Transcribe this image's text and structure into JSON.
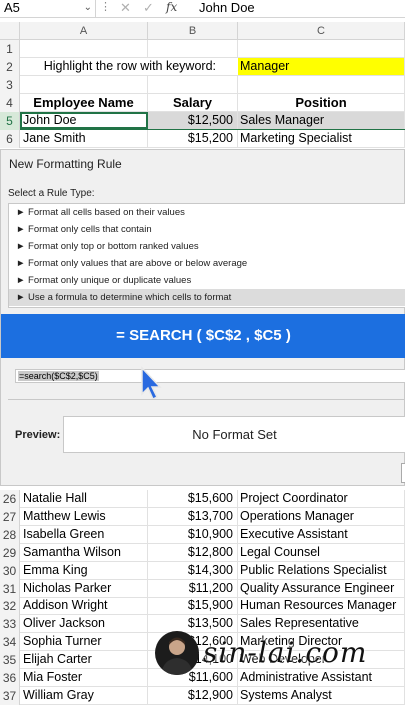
{
  "formula_bar": {
    "name_box": "A5",
    "cancel_icon": "✕",
    "enter_icon": "✓",
    "fx": "fx",
    "value": "John Doe"
  },
  "columns": [
    "A",
    "B",
    "C"
  ],
  "top_rows": [
    {
      "num": "1",
      "a": "",
      "b": "",
      "c": ""
    },
    {
      "num": "2",
      "label": "Highlight the row with keyword:",
      "keyword": "Manager"
    },
    {
      "num": "3",
      "a": "",
      "b": "",
      "c": ""
    },
    {
      "num": "4",
      "a": "Employee Name",
      "b": "Salary",
      "c": "Position"
    },
    {
      "num": "5",
      "a": "John Doe",
      "b": "$12,500",
      "c": "Sales Manager"
    },
    {
      "num": "6",
      "a": "Jane Smith",
      "b": "$15,200",
      "c": "Marketing Specialist"
    }
  ],
  "dialog": {
    "title": "New Formatting Rule",
    "select_label": "Select a Rule Type:",
    "rules": [
      "► Format all cells based on their values",
      "► Format only cells that contain",
      "► Format only top or bottom ranked values",
      "► Format only values that are above or below average",
      "► Format only unique or duplicate values",
      "► Use a formula to determine which cells to format"
    ],
    "selected_rule_index": 5,
    "banner": "= SEARCH ( $C$2 , $C5 )",
    "formula": "=search($C$2,$C5)",
    "preview_label": "Preview:",
    "preview_text": "No Format Set"
  },
  "bottom_rows": [
    {
      "num": "26",
      "a": "Natalie Hall",
      "b": "$15,600",
      "c": "Project Coordinator"
    },
    {
      "num": "27",
      "a": "Matthew Lewis",
      "b": "$13,700",
      "c": "Operations Manager"
    },
    {
      "num": "28",
      "a": "Isabella Green",
      "b": "$10,900",
      "c": "Executive Assistant"
    },
    {
      "num": "29",
      "a": "Samantha Wilson",
      "b": "$12,800",
      "c": "Legal Counsel"
    },
    {
      "num": "30",
      "a": "Emma King",
      "b": "$14,300",
      "c": "Public Relations Specialist"
    },
    {
      "num": "31",
      "a": "Nicholas Parker",
      "b": "$11,200",
      "c": "Quality Assurance Engineer"
    },
    {
      "num": "32",
      "a": "Addison Wright",
      "b": "$15,900",
      "c": "Human Resources Manager"
    },
    {
      "num": "33",
      "a": "Oliver Jackson",
      "b": "$13,500",
      "c": "Sales Representative"
    },
    {
      "num": "34",
      "a": "Sophia Turner",
      "b": "$12,600",
      "c": "Marketing Director"
    },
    {
      "num": "35",
      "a": "Elijah Carter",
      "b": "$14,100",
      "c": "Web Developer"
    },
    {
      "num": "36",
      "a": "Mia Foster",
      "b": "$11,600",
      "c": "Administrative Assistant"
    },
    {
      "num": "37",
      "a": "William Gray",
      "b": "$12,900",
      "c": "Systems Analyst"
    }
  ],
  "watermark": "sin-lai.com",
  "colors": {
    "header_green": "#217346",
    "keyword_yellow": "#ffff00",
    "banner_blue": "#1c6fe0"
  }
}
